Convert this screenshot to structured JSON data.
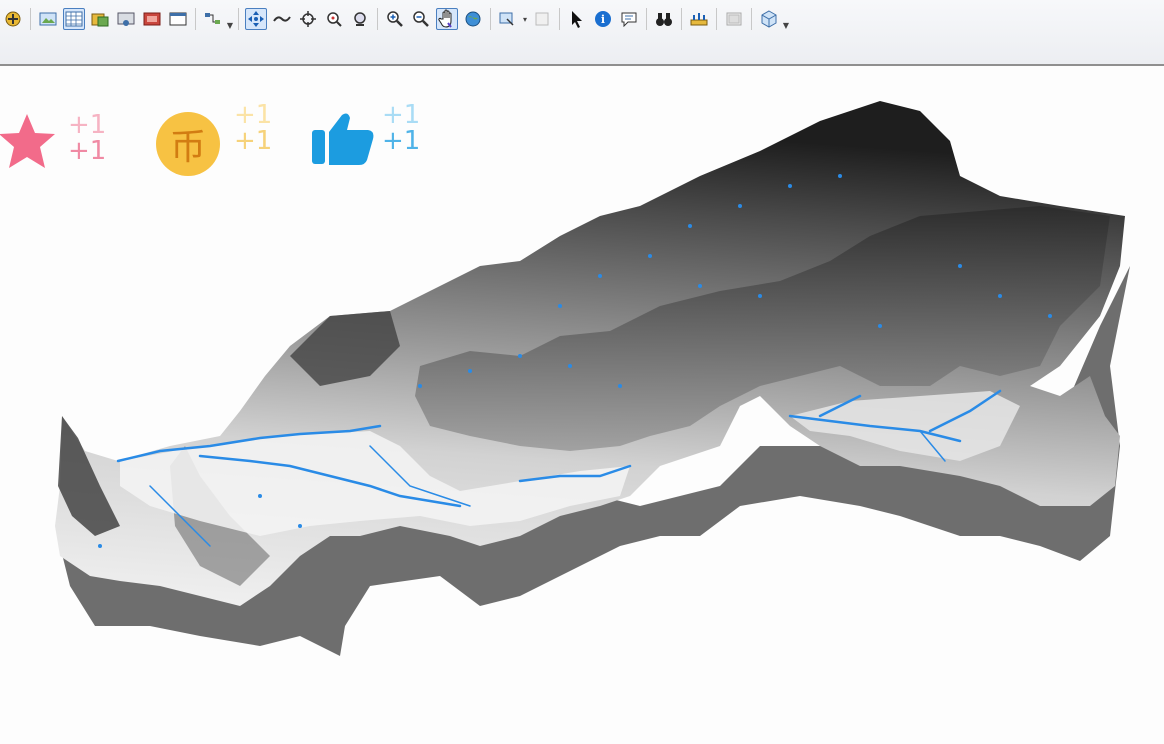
{
  "toolbar": {
    "buttons": [
      {
        "name": "add-data-icon"
      },
      {
        "name": "map-layout-icon"
      },
      {
        "name": "attribute-table-icon",
        "active": true
      },
      {
        "name": "catalog-icon"
      },
      {
        "name": "toolbox-icon"
      },
      {
        "name": "python-window-icon"
      },
      {
        "name": "model-builder-icon"
      },
      {
        "name": "pan-3d-icon",
        "active": true
      },
      {
        "name": "fly-icon"
      },
      {
        "name": "target-center-icon"
      },
      {
        "name": "zoom-to-target-icon"
      },
      {
        "name": "set-observer-icon"
      },
      {
        "name": "zoom-in-icon"
      },
      {
        "name": "zoom-out-icon"
      },
      {
        "name": "hand-pan-icon",
        "active": true
      },
      {
        "name": "full-extent-icon"
      },
      {
        "name": "navigate-dropdown-icon"
      },
      {
        "name": "clear-selection-icon"
      },
      {
        "name": "select-pointer-icon"
      },
      {
        "name": "identify-icon"
      },
      {
        "name": "html-popup-icon"
      },
      {
        "name": "find-binoculars-icon"
      },
      {
        "name": "measure-icon"
      },
      {
        "name": "scene-properties-icon"
      },
      {
        "name": "3d-effects-icon"
      }
    ]
  },
  "reactions": {
    "like_plus_top": "+1",
    "like_plus_bottom": "+1",
    "coin_plus_top": "+1",
    "coin_plus_bottom": "+1",
    "thumb_plus_top": "+1",
    "thumb_plus_bottom": "+1",
    "coin_glyph": "币",
    "colors": {
      "star": "#f26b8a",
      "coin": "#f7c243",
      "thumb": "#1c9ce0"
    }
  },
  "scene": {
    "colors": {
      "shadow": "#6e6e6e",
      "river": "#2a8be6",
      "terrain_dark": "#1a1a1a",
      "terrain_light": "#f4f4f4"
    }
  }
}
